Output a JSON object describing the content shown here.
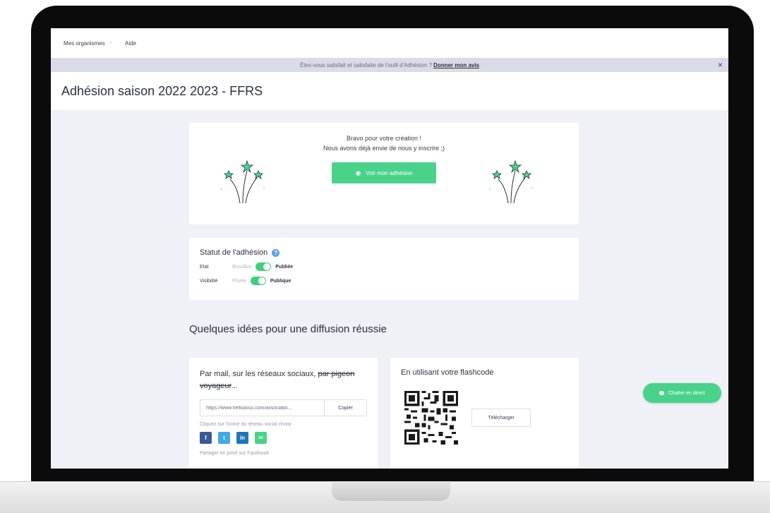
{
  "nav": {
    "organisations": "Mes organismes",
    "help": "Aide"
  },
  "banner": {
    "text": "Êtes-vous satisfait et satisfaite de l'outil d'Adhésion ?",
    "link": "Donner mon avis",
    "close": "×"
  },
  "page": {
    "title": "Adhésion saison 2022 2023 - FFRS"
  },
  "bravo": {
    "line1": "Bravo pour votre création !",
    "line2": "Nous avons déjà envie de nous y inscrire ;)",
    "button": "Voir mon adhésion"
  },
  "status": {
    "title": "Statut de l'adhésion",
    "help": "?",
    "rows": [
      {
        "label": "Etat",
        "off": "Brouillon",
        "on": "Publiée"
      },
      {
        "label": "Visibilité",
        "off": "Privée",
        "on": "Publique"
      }
    ]
  },
  "section": {
    "title": "Quelques idées pour une diffusion réussie"
  },
  "mail": {
    "title_plain": "Par mail, sur les réseaux sociaux, ",
    "title_struck": "par pigeon voyageur",
    "title_end": "...",
    "link_value": "https://www.helloasso.com/associatio...",
    "copy": "Copier",
    "hint": "Cliquez sur l'icone du réseau social choisi",
    "social": [
      {
        "label": "f",
        "color": "#3b5998"
      },
      {
        "label": "t",
        "color": "#42a8e8"
      },
      {
        "label": "in",
        "color": "#1f77b5"
      },
      {
        "label": "✉",
        "color": "#49d38a"
      }
    ],
    "share_note": "Partager en privé sur Facebook"
  },
  "flash": {
    "title": "En utilisant votre flashcode",
    "download": "Télécharger"
  },
  "chat": {
    "label": "Chatter en direct"
  },
  "colors": {
    "accent_green": "#49d38a",
    "background": "#eff1f6"
  }
}
